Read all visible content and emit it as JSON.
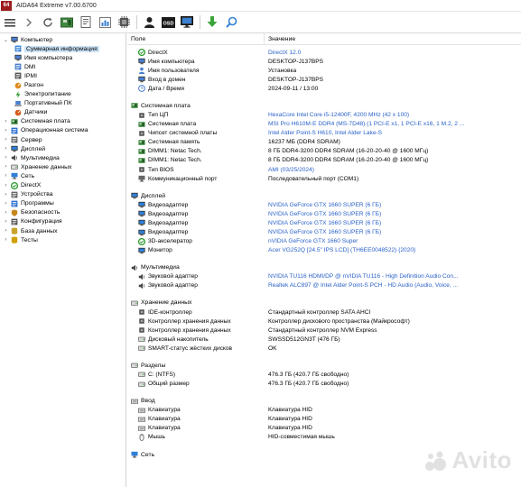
{
  "window": {
    "icon_text": "64",
    "title": "AIDA64 Extreme v7.00.6700"
  },
  "toolbar": {
    "icons": [
      "menu-icon",
      "forward-icon",
      "refresh-icon",
      "motherboard-icon",
      "report-icon",
      "chart-icon",
      "cpu-icon",
      "user-icon",
      "osd-icon",
      "monitor-icon",
      "download-icon",
      "search-icon"
    ],
    "osd_label": "OSD"
  },
  "tree": {
    "items": [
      {
        "label": "Компьютер",
        "level": 0,
        "expander": "⌄",
        "icon": "computer-icon",
        "color": "#4a7fcf"
      },
      {
        "label": "Суммарная информация",
        "level": 1,
        "icon": "summary-icon",
        "color": "#3a86d8",
        "selected": true
      },
      {
        "label": "Имя компьютера",
        "level": 1,
        "icon": "computer-name-icon",
        "color": "#4a7fcf"
      },
      {
        "label": "DMI",
        "level": 1,
        "icon": "dmi-icon",
        "color": "#4a7fcf"
      },
      {
        "label": "IPMI",
        "level": 1,
        "icon": "ipmi-icon",
        "color": "#555555"
      },
      {
        "label": "Разгон",
        "level": 1,
        "icon": "overclock-icon",
        "color": "#e08a1e"
      },
      {
        "label": "Электропитание",
        "level": 1,
        "icon": "power-icon",
        "color": "#2f9a2f"
      },
      {
        "label": "Портативный ПК",
        "level": 1,
        "icon": "laptop-icon",
        "color": "#4a7fcf"
      },
      {
        "label": "Датчики",
        "level": 1,
        "icon": "sensor-icon",
        "color": "#d65a1b"
      },
      {
        "label": "Системная плата",
        "level": 0,
        "expander": "›",
        "icon": "motherboard-icon",
        "color": "#3f8a3f"
      },
      {
        "label": "Операционная система",
        "level": 0,
        "expander": "›",
        "icon": "os-icon",
        "color": "#2a6fd0"
      },
      {
        "label": "Сервер",
        "level": 0,
        "expander": "›",
        "icon": "server-icon",
        "color": "#666666"
      },
      {
        "label": "Дисплей",
        "level": 0,
        "expander": "›",
        "icon": "display-icon",
        "color": "#2f7fd8"
      },
      {
        "label": "Мультимедиа",
        "level": 0,
        "expander": "›",
        "icon": "multimedia-icon",
        "color": "#444444"
      },
      {
        "label": "Хранение данных",
        "level": 0,
        "expander": "›",
        "icon": "storage-icon",
        "color": "#666666"
      },
      {
        "label": "Сеть",
        "level": 0,
        "expander": "›",
        "icon": "network-icon",
        "color": "#2f7fd8"
      },
      {
        "label": "DirectX",
        "level": 0,
        "expander": "›",
        "icon": "directx-icon",
        "color": "#2f9a2f"
      },
      {
        "label": "Устройства",
        "level": 0,
        "expander": "›",
        "icon": "devices-icon",
        "color": "#666666"
      },
      {
        "label": "Программы",
        "level": 0,
        "expander": "›",
        "icon": "programs-icon",
        "color": "#2a6fd0"
      },
      {
        "label": "Безопасность",
        "level": 0,
        "expander": "›",
        "icon": "security-icon",
        "color": "#c7861e"
      },
      {
        "label": "Конфигурация",
        "level": 0,
        "expander": "›",
        "icon": "config-icon",
        "color": "#555555"
      },
      {
        "label": "База данных",
        "level": 0,
        "expander": "›",
        "icon": "database-icon",
        "color": "#c9a42a"
      },
      {
        "label": "Тесты",
        "level": 0,
        "expander": "›",
        "icon": "tests-icon",
        "color": "#d0a000"
      }
    ]
  },
  "columns": {
    "field": "Поле",
    "value": "Значение"
  },
  "sections": [
    {
      "title": null,
      "rows": [
        {
          "icon": "directx-icon",
          "color": "#2f9a2f",
          "field": "DirectX",
          "value": "DirectX 12.0",
          "link": true
        },
        {
          "icon": "computer-name-icon",
          "color": "#4a7fcf",
          "field": "Имя компьютера",
          "value": "DESKTOP-J137BPS"
        },
        {
          "icon": "user-icon",
          "color": "#4a7fcf",
          "field": "Имя пользователя",
          "value": "Установка"
        },
        {
          "icon": "domain-icon",
          "color": "#4a7fcf",
          "field": "Вход в домен",
          "value": "DESKTOP-J137BPS"
        },
        {
          "icon": "clock-icon",
          "color": "#4a7fcf",
          "field": "Дата / Время",
          "value": "2024-09-11 / 13:00"
        }
      ]
    },
    {
      "title": "Системная плата",
      "icon": "motherboard-icon",
      "color": "#3f8a3f",
      "rows": [
        {
          "icon": "cpu-icon",
          "color": "#444444",
          "field": "Тип ЦП",
          "value": "HexaCore Intel Core i5-12400F, 4200 MHz (42 x 100)",
          "link": true
        },
        {
          "icon": "motherboard-icon",
          "color": "#3f8a3f",
          "field": "Системная плата",
          "value": "MSI Pro H610M-E DDR4 (MS-7D48)  (1 PCI-E x1, 1 PCI-E x16, 1 M.2, 2 ...",
          "link": true
        },
        {
          "icon": "chipset-icon",
          "color": "#444444",
          "field": "Чипсет системной платы",
          "value": "Intel Alder Point-S H610, Intel Alder Lake-S",
          "link": true
        },
        {
          "icon": "memory-icon",
          "color": "#3f8a3f",
          "field": "Системная память",
          "value": "16237 МБ  (DDR4 SDRAM)"
        },
        {
          "icon": "memory-icon",
          "color": "#3f8a3f",
          "field": "DIMM1: Netac Tech.",
          "value": "8 ГБ DDR4-3200 DDR4 SDRAM  (16-20-20-40 @ 1600 МГц)"
        },
        {
          "icon": "memory-icon",
          "color": "#3f8a3f",
          "field": "DIMM1: Netac Tech.",
          "value": "8 ГБ DDR4-3200 DDR4 SDRAM  (16-20-20-40 @ 1600 МГц)"
        },
        {
          "icon": "bios-icon",
          "color": "#444444",
          "field": "Тип BIOS",
          "value": "AMI (03/25/2024)",
          "link": true
        },
        {
          "icon": "port-icon",
          "color": "#666666",
          "field": "Коммуникационный порт",
          "value": "Последовательный порт (COM1)"
        }
      ]
    },
    {
      "title": "Дисплей",
      "icon": "display-icon",
      "color": "#2f7fd8",
      "rows": [
        {
          "icon": "gpu-icon",
          "color": "#2f7fd8",
          "field": "Видеоадаптер",
          "value": "NVIDIA GeForce GTX 1660 SUPER  (6 ГБ)",
          "link": true
        },
        {
          "icon": "gpu-icon",
          "color": "#2f7fd8",
          "field": "Видеоадаптер",
          "value": "NVIDIA GeForce GTX 1660 SUPER  (6 ГБ)",
          "link": true
        },
        {
          "icon": "gpu-icon",
          "color": "#2f7fd8",
          "field": "Видеоадаптер",
          "value": "NVIDIA GeForce GTX 1660 SUPER  (6 ГБ)",
          "link": true
        },
        {
          "icon": "gpu-icon",
          "color": "#2f7fd8",
          "field": "Видеоадаптер",
          "value": "NVIDIA GeForce GTX 1660 SUPER  (6 ГБ)",
          "link": true
        },
        {
          "icon": "3d-icon",
          "color": "#2f9a2f",
          "field": "3D-акселератор",
          "value": "nVIDIA GeForce GTX 1660 Super",
          "link": true
        },
        {
          "icon": "monitor-icon",
          "color": "#2f7fd8",
          "field": "Монитор",
          "value": "Acer VG252Q  [24.5\" IPS LCD]  (TH6EE0048522)  {2020}",
          "link": true
        }
      ]
    },
    {
      "title": "Мультимедиа",
      "icon": "multimedia-icon",
      "color": "#444444",
      "rows": [
        {
          "icon": "audio-icon",
          "color": "#444444",
          "field": "Звуковой адаптер",
          "value": "NVIDIA TU116 HDMI/DP @ nVIDIA TU116 - High Definition Audio Con...",
          "link": true
        },
        {
          "icon": "audio-icon",
          "color": "#444444",
          "field": "Звуковой адаптер",
          "value": "Realtek ALC897 @ Intel Alder Point-S PCH - HD Audio (Audio, Voice, ...",
          "link": true
        }
      ]
    },
    {
      "title": "Хранение данных",
      "icon": "storage-icon",
      "color": "#666666",
      "rows": [
        {
          "icon": "ide-icon",
          "color": "#444444",
          "field": "IDE-контроллер",
          "value": "Стандартный контроллер SATA AHCI"
        },
        {
          "icon": "controller-icon",
          "color": "#444444",
          "field": "Контроллер хранения данных",
          "value": "Контроллер дискового пространства (Майкрософт)"
        },
        {
          "icon": "controller-icon",
          "color": "#444444",
          "field": "Контроллер хранения данных",
          "value": "Стандартный контроллер NVM Express"
        },
        {
          "icon": "disk-icon",
          "color": "#666666",
          "field": "Дисковый накопитель",
          "value": "SWSSD512GN3T  (476 ГБ)"
        },
        {
          "icon": "smart-icon",
          "color": "#666666",
          "field": "SMART-статус жёстких дисков",
          "value": "OK"
        }
      ]
    },
    {
      "title": "Разделы",
      "icon": "partitions-icon",
      "color": "#666666",
      "rows": [
        {
          "icon": "drive-icon",
          "color": "#666666",
          "field": "C: (NTFS)",
          "value": "476.3 ГБ (420.7 ГБ свободно)"
        },
        {
          "icon": "drive-icon",
          "color": "#666666",
          "field": "Общий размер",
          "value": "476.3 ГБ (420.7 ГБ свободно)"
        }
      ]
    },
    {
      "title": "Ввод",
      "icon": "input-icon",
      "color": "#555555",
      "rows": [
        {
          "icon": "keyboard-icon",
          "color": "#555555",
          "field": "Клавиатура",
          "value": "Клавиатура HID"
        },
        {
          "icon": "keyboard-icon",
          "color": "#555555",
          "field": "Клавиатура",
          "value": "Клавиатура HID"
        },
        {
          "icon": "keyboard-icon",
          "color": "#555555",
          "field": "Клавиатура",
          "value": "Клавиатура HID"
        },
        {
          "icon": "mouse-icon",
          "color": "#555555",
          "field": "Мышь",
          "value": "HID-совместимая мышь"
        }
      ]
    },
    {
      "title": "Сеть",
      "icon": "network-icon",
      "color": "#2f7fd8",
      "rows": []
    }
  ],
  "watermark": {
    "text": "Avito"
  }
}
